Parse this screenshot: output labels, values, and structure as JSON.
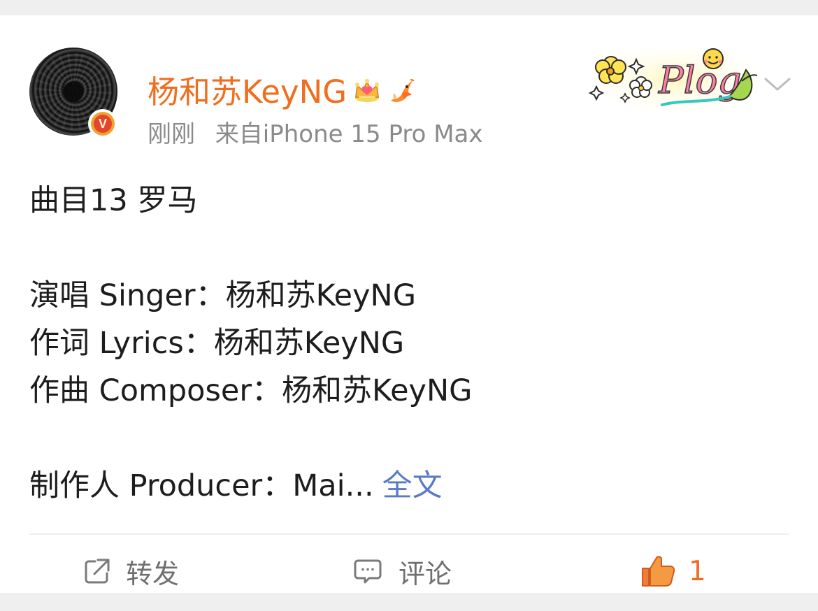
{
  "post": {
    "username": "杨和苏KeyNG",
    "time": "刚刚",
    "source": "来自iPhone 15 Pro Max",
    "badge_letter": "V",
    "sticker_text": "Plog",
    "content": {
      "line1": "曲目13 罗马",
      "line2": "演唱 Singer：杨和苏KeyNG",
      "line3": "作词 Lyrics：杨和苏KeyNG",
      "line4": "作曲 Composer：杨和苏KeyNG",
      "line5": "制作人 Producer：Mai...",
      "expand": "全文"
    },
    "actions": {
      "repost_label": "转发",
      "comment_label": "评论",
      "like_count": "1"
    },
    "icons": {
      "crown": "crown-icon",
      "fish": "fish-icon",
      "dropdown": "chevron-down-icon",
      "repost": "repost-icon",
      "comment": "comment-icon",
      "like": "thumbs-up-icon"
    },
    "colors": {
      "username": "#f06e1f",
      "meta": "#8a8a8a",
      "link": "#5a7ac6",
      "action_text": "#6f6f6f",
      "like": "#ef6f22",
      "badge_red": "#e2472c",
      "badge_gold": "#f0a22f"
    }
  }
}
